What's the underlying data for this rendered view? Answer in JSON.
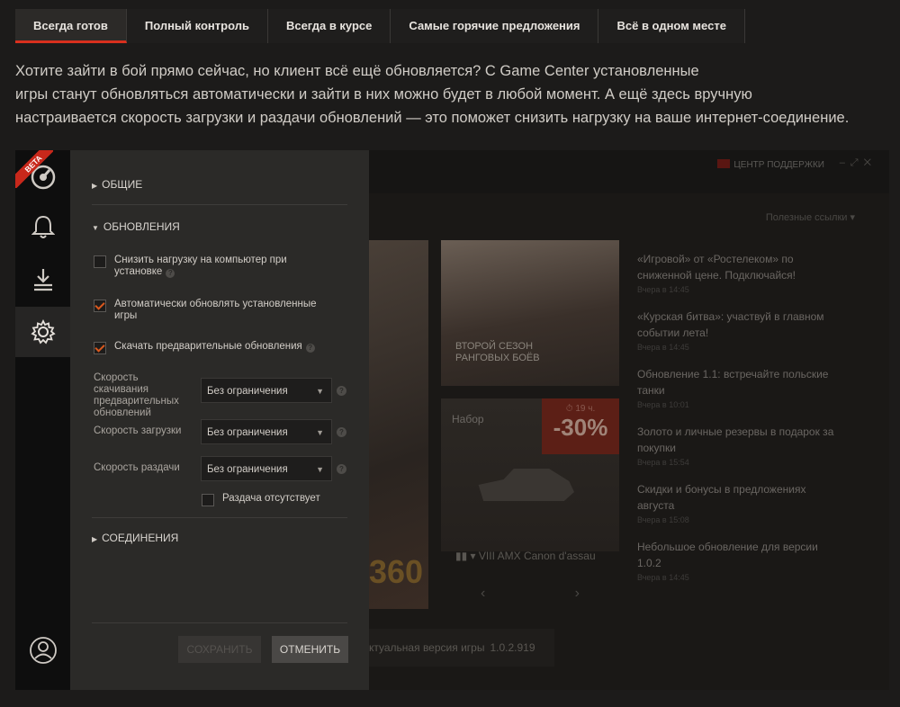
{
  "tabs": [
    {
      "label": "Всегда готов",
      "active": true
    },
    {
      "label": "Полный контроль",
      "active": false
    },
    {
      "label": "Всегда в курсе",
      "active": false
    },
    {
      "label": "Самые горячие предложения",
      "active": false
    },
    {
      "label": "Всё в одном месте",
      "active": false
    }
  ],
  "intro": {
    "line1": "Хотите зайти в бой прямо сейчас, но клиент всё ещё обновляется? С Game Center установленные",
    "line2": "игры станут обновляться автоматически и зайти в них можно будет в любой момент. А ещё здесь вручную",
    "line3": "настраивается скорость загрузки и раздачи обновлений — это поможет снизить нагрузку на ваше интернет-соединение."
  },
  "rail": {
    "beta": "BETA",
    "icons": [
      "logo-icon",
      "bell-icon",
      "download-icon",
      "gear-icon",
      "user-icon"
    ]
  },
  "settings": {
    "general": "ОБЩИЕ",
    "updates": "ОБНОВЛЕНИЯ",
    "reduce_load": {
      "label": "Снизить нагрузку на компьютер при установке",
      "checked": false
    },
    "auto_update": {
      "label": "Автоматически обновлять установленные игры",
      "checked": true
    },
    "pre_download": {
      "label": "Скачать предварительные обновления",
      "checked": true
    },
    "pre_speed": {
      "label": "Скорость скачивания предварительных обновлений",
      "value": "Без ограничения"
    },
    "dl_speed": {
      "label": "Скорость загрузки",
      "value": "Без ограничения"
    },
    "seed_speed": {
      "label": "Скорость раздачи",
      "value": "Без ограничения"
    },
    "no_seed": {
      "label": "Раздача отсутствует",
      "checked": false
    },
    "connections": "СОЕДИНЕНИЯ",
    "save": "СОХРАНИТЬ",
    "cancel": "ОТМЕНИТЬ"
  },
  "client": {
    "support": "ЦЕНТР ПОДДЕРЖКИ",
    "useful_links": "Полезные ссылки",
    "card1_caption_1": "ВТОРОЙ СЕЗОН",
    "card1_caption_2": "РАНГОВЫХ БОЁВ",
    "set_label": "Набор",
    "discount_time": "19 ч.",
    "discount": "-30%",
    "vehicle": "VIII AMX Canon d'assau",
    "badge": "360",
    "version_label": "ктуальная версия игры",
    "version": "1.0.2.919",
    "news": [
      {
        "title": "«Игровой» от «Ростелеком» по сниженной цене. Подключайся!",
        "date": "Вчера в 14:45"
      },
      {
        "title": "«Курская битва»: участвуй в главном событии лета!",
        "date": "Вчера в 14:45"
      },
      {
        "title": "Обновление 1.1: встречайте польские танки",
        "date": "Вчера в 10:01"
      },
      {
        "title": "Золото и личные резервы в подарок за покупки",
        "date": "Вчера в 15:54"
      },
      {
        "title": "Скидки и бонусы в предложениях августа",
        "date": "Вчера в 15:08"
      },
      {
        "title": "Небольшое обновление для версии 1.0.2",
        "date": "Вчера в 14:45"
      }
    ]
  }
}
